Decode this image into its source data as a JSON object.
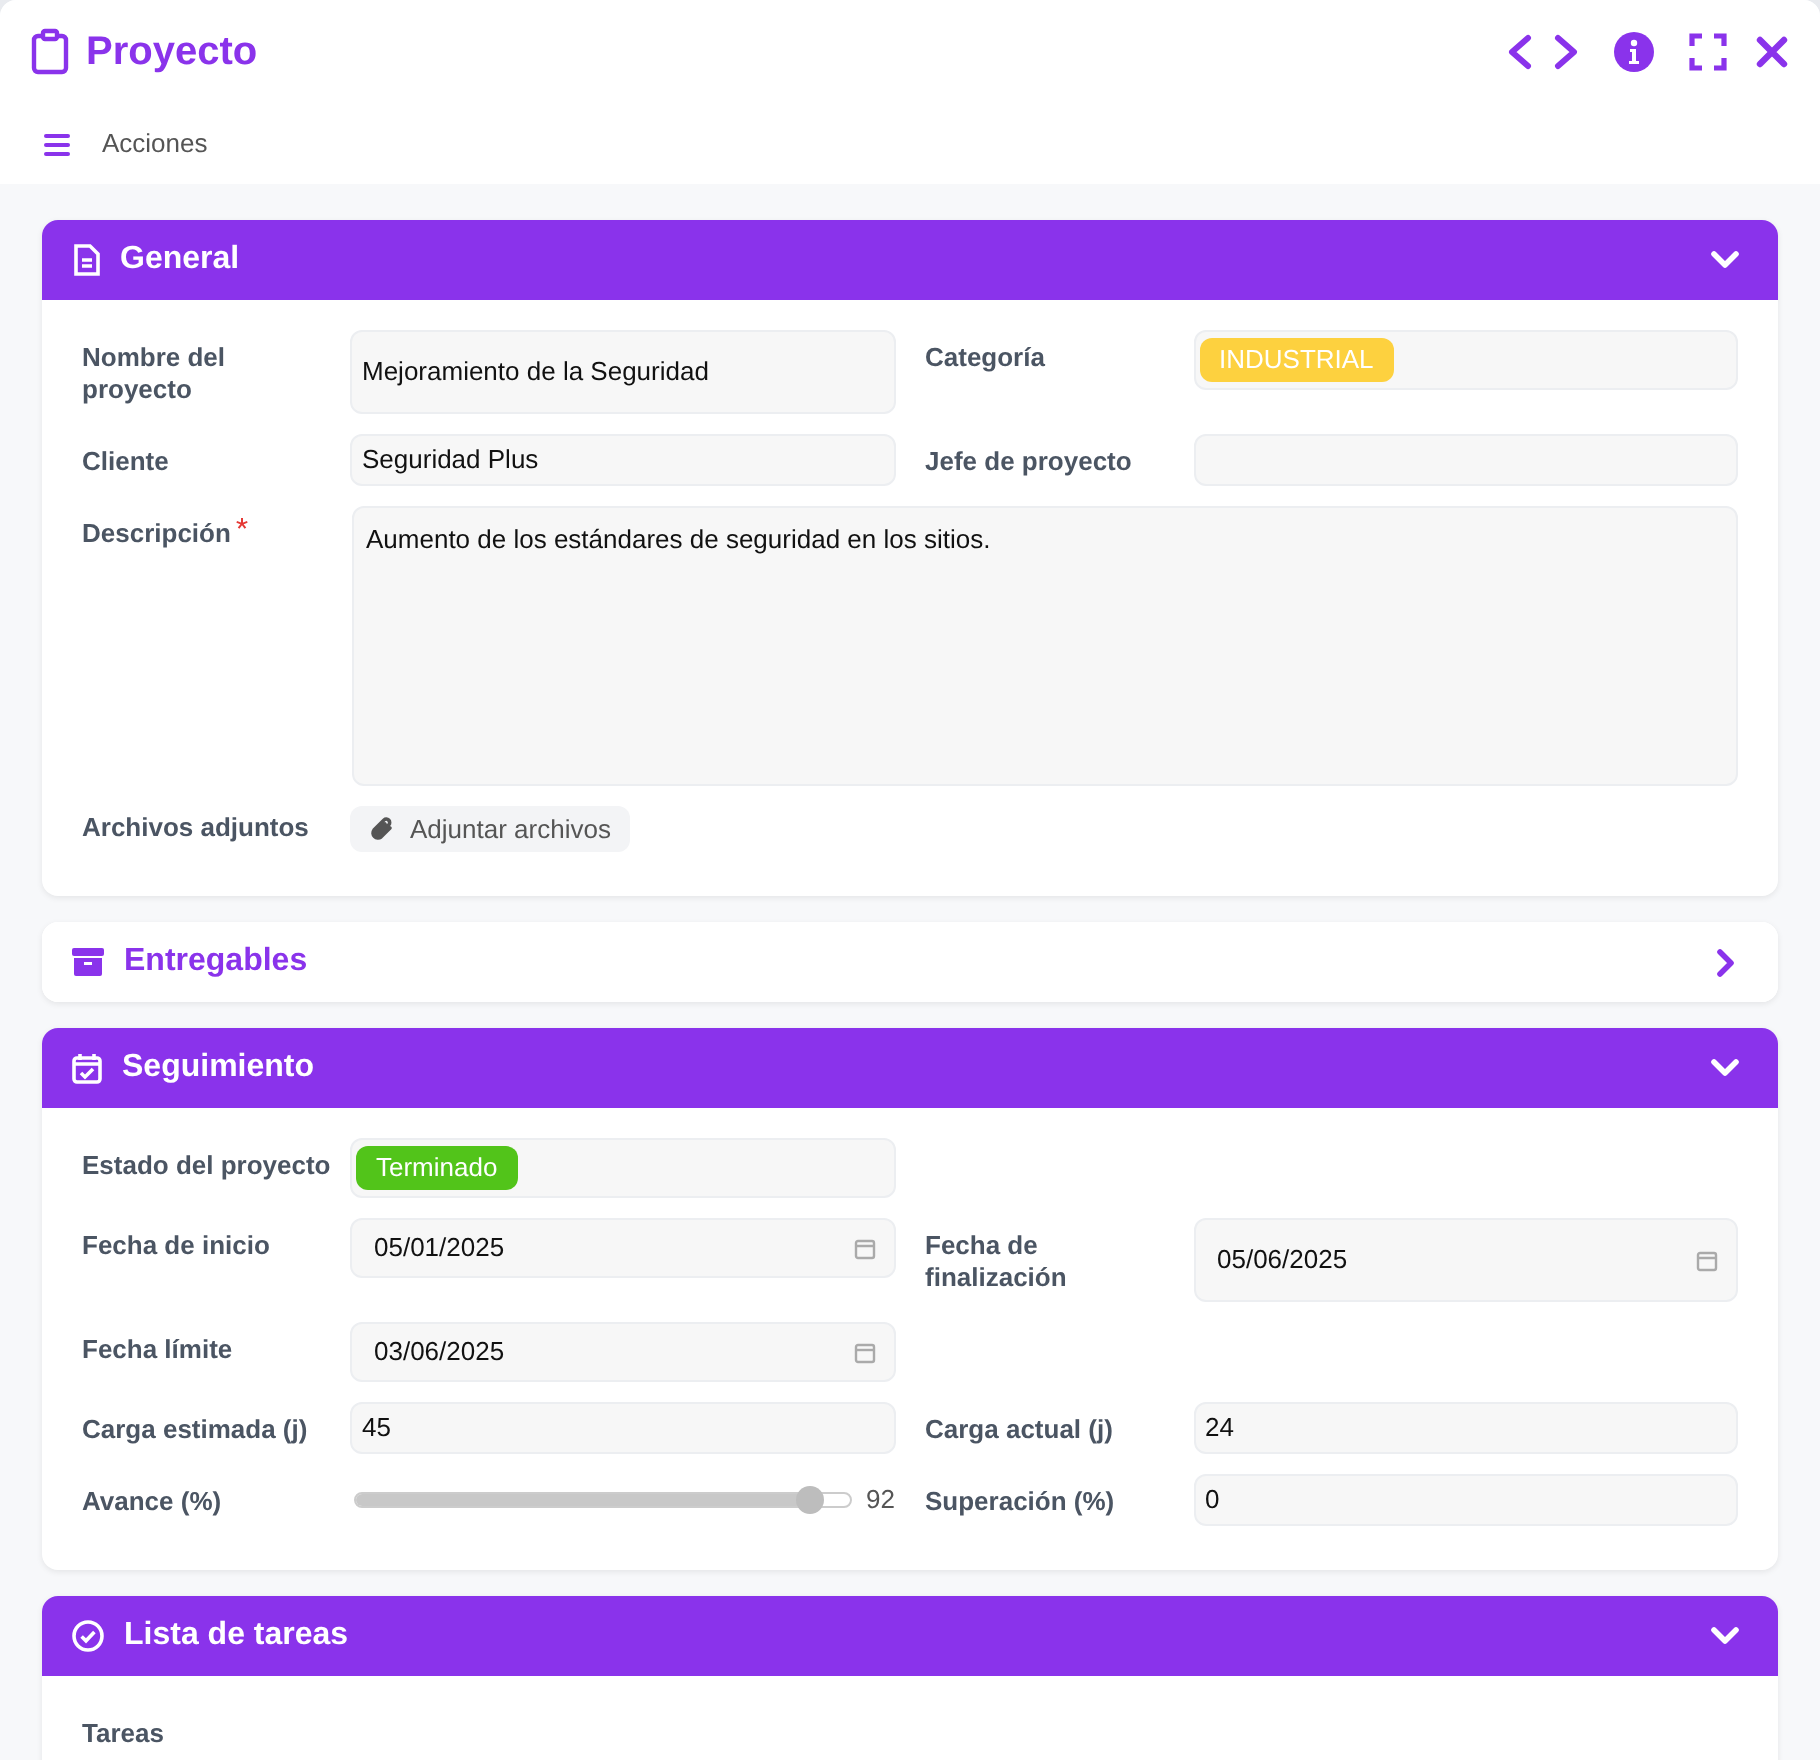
{
  "window": {
    "title": "Proyecto"
  },
  "toolbar": {
    "menu_label": "Acciones"
  },
  "sections": [
    {
      "title": "General",
      "expanded": true,
      "rows": [
        [
          {
            "kind": "text",
            "label": "Nombre del proyecto",
            "value": "Mejoramiento de la Seguridad"
          },
          {
            "kind": "tag",
            "label": "Categoría",
            "tag": "INDUSTRIAL",
            "color": "#fdd13f"
          }
        ],
        [
          {
            "kind": "text",
            "label": "Cliente",
            "value": "Seguridad Plus"
          },
          {
            "kind": "text",
            "label": "Jefe de proyecto"
          }
        ],
        [
          {
            "kind": "textarea",
            "label": "Descripción",
            "required": true,
            "value": "Aumento de los estándares de seguridad en los sitios."
          }
        ],
        [
          {
            "kind": "button",
            "label": "Archivos adjuntos",
            "button": "Adjuntar archivos"
          }
        ]
      ]
    },
    {
      "title": "Entregables",
      "expanded": false
    },
    {
      "title": "Seguimiento",
      "expanded": true,
      "rows": [
        [
          {
            "kind": "tag",
            "label": "Estado del proyecto",
            "tag": "Terminado",
            "color": "#52c41a"
          }
        ],
        [
          {
            "kind": "date",
            "label": "Fecha de inicio",
            "value": "05/01/2025"
          },
          {
            "kind": "date",
            "label": "Fecha de finalización",
            "value": "05/06/2025"
          }
        ],
        [
          {
            "kind": "date",
            "label": "Fecha límite",
            "value": "03/06/2025"
          }
        ],
        [
          {
            "kind": "text",
            "label": "Carga estimada (j)",
            "value": "45"
          },
          {
            "kind": "text",
            "label": "Carga actual (j)",
            "value": "24"
          }
        ],
        [
          {
            "kind": "slider",
            "label": "Avance (%)",
            "level": 0.92,
            "reading": "92"
          },
          {
            "kind": "text",
            "label": "Superación (%)",
            "value": "0"
          }
        ]
      ]
    },
    {
      "title": "Lista de tareas",
      "expanded": true,
      "rows": [
        [
          {
            "kind": "label",
            "label": "Tareas"
          }
        ]
      ]
    }
  ]
}
